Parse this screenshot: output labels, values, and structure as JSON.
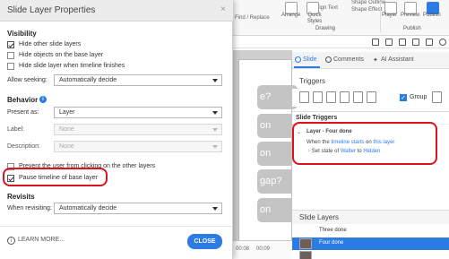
{
  "ribbon": {
    "arrange_label": "Arrange",
    "quick_styles_label": "Quick Styles",
    "align_text": "Align Text",
    "shape_outline": "Shape Outline",
    "shape_effect": "Shape Effect",
    "find_replace": "Find / Replace",
    "drawing_group": "Drawing",
    "player_label": "Player",
    "preview_label": "Preview",
    "publish_label": "Publish",
    "publish_group": "Publish"
  },
  "slide": {
    "partial_texts": [
      "e?",
      "on",
      "on",
      "gap?",
      "on"
    ]
  },
  "timeline": {
    "time_a": "00:08",
    "time_b": "00:09"
  },
  "right_panel": {
    "tabs": [
      {
        "label": "Slide",
        "active": true
      },
      {
        "label": "Comments",
        "active": false
      },
      {
        "label": "AI Assistant",
        "active": false
      }
    ],
    "triggers_title": "Triggers",
    "group_label": "Group",
    "group_checked": true,
    "slide_triggers_title": "Slide Triggers",
    "trigger": {
      "name": "Layer - Four done",
      "when": "When the",
      "when_link": "timeline starts",
      "on": "on",
      "on_link": "this layer",
      "action_prefix": "Set state of",
      "target": "Walter",
      "to": "to",
      "state": "Hidden"
    },
    "slide_layers_title": "Slide Layers",
    "layers": [
      {
        "name": "Three done",
        "selected": false
      },
      {
        "name": "Four done",
        "selected": true
      }
    ]
  },
  "dialog": {
    "title": "Slide Layer Properties",
    "close_icon": "×",
    "visibility_title": "Visibility",
    "visibility_options": [
      {
        "label": "Hide other slide layers",
        "checked": true
      },
      {
        "label": "Hide objects on the base layer",
        "checked": false
      },
      {
        "label": "Hide slide layer when timeline finishes",
        "checked": false
      }
    ],
    "allow_seeking_label": "Allow seeking:",
    "allow_seeking_value": "Automatically decide",
    "behavior_title": "Behavior",
    "present_as_label": "Present as:",
    "present_as_value": "Layer",
    "label_label": "Label:",
    "label_value": "None",
    "description_label": "Description:",
    "description_value": "None",
    "behavior_options": [
      {
        "label": "Prevent the user from clicking on the other layers",
        "checked": false
      },
      {
        "label": "Pause timeline of base layer",
        "checked": true
      }
    ],
    "revisits_title": "Revisits",
    "when_revisiting_label": "When revisiting:",
    "when_revisiting_value": "Automatically decide",
    "learn_more": "LEARN MORE...",
    "close_button": "CLOSE"
  },
  "colors": {
    "accent": "#2d7be5",
    "highlight_red": "#d6161e"
  }
}
